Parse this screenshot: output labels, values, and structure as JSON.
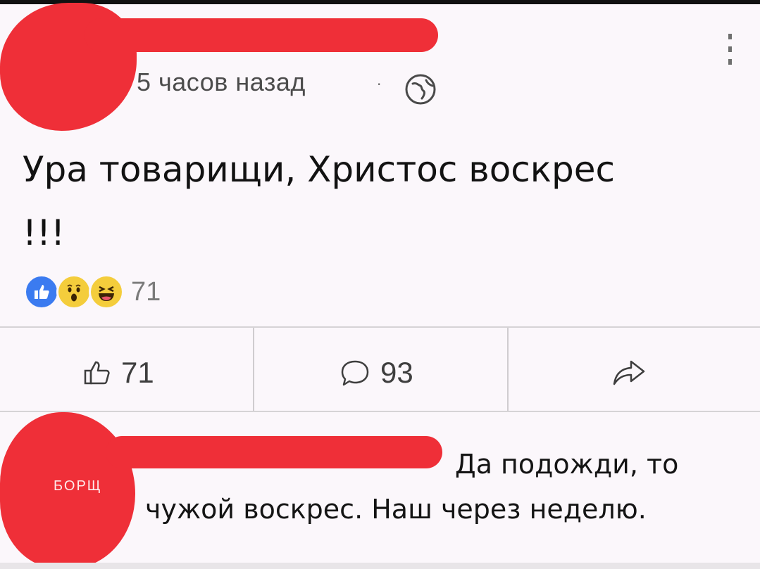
{
  "post": {
    "timestamp": "5 часов назад",
    "separator": "·",
    "privacy_icon": "globe-icon",
    "text": "Ура товарищи, Христос воскрес !!!",
    "reactions": {
      "icons": [
        "like-reaction-icon",
        "wow-reaction-icon",
        "haha-reaction-icon"
      ],
      "count": "71"
    }
  },
  "actions": {
    "like": {
      "icon": "thumbs-up-icon",
      "count": "71"
    },
    "comment": {
      "icon": "comment-bubble-icon",
      "count": "93"
    },
    "share": {
      "icon": "share-arrow-icon"
    }
  },
  "comment": {
    "author_tag": "БОРЩ",
    "text_line1": "Да подожди, то",
    "text_line2": "чужой воскрес. Наш через неделю."
  },
  "colors": {
    "background": "#fbf7fb",
    "redaction": "#ef2f38",
    "like_blue": "#3b7bf0",
    "emoji_yellow": "#f4cd3c",
    "divider": "#d6d3d6"
  }
}
